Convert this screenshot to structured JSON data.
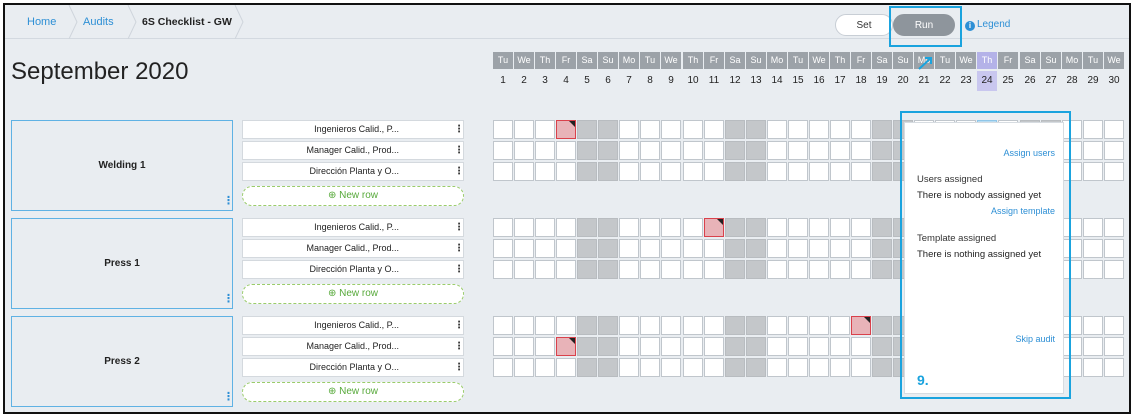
{
  "breadcrumb": {
    "home": "Home",
    "audits": "Audits",
    "current": "6S Checklist - GW"
  },
  "mode": {
    "set_label": "Set",
    "run_label": "Run",
    "legend_label": "Legend"
  },
  "month_title": "September 2020",
  "days": [
    {
      "abbr": "Tu",
      "num": "1"
    },
    {
      "abbr": "We",
      "num": "2"
    },
    {
      "abbr": "Th",
      "num": "3"
    },
    {
      "abbr": "Fr",
      "num": "4"
    },
    {
      "abbr": "Sa",
      "num": "5"
    },
    {
      "abbr": "Su",
      "num": "6"
    },
    {
      "abbr": "Mo",
      "num": "7"
    },
    {
      "abbr": "Tu",
      "num": "8"
    },
    {
      "abbr": "We",
      "num": "9"
    },
    {
      "abbr": "Th",
      "num": "10"
    },
    {
      "abbr": "Fr",
      "num": "11"
    },
    {
      "abbr": "Sa",
      "num": "12"
    },
    {
      "abbr": "Su",
      "num": "13"
    },
    {
      "abbr": "Mo",
      "num": "14"
    },
    {
      "abbr": "Tu",
      "num": "15"
    },
    {
      "abbr": "We",
      "num": "16"
    },
    {
      "abbr": "Th",
      "num": "17"
    },
    {
      "abbr": "Fr",
      "num": "18"
    },
    {
      "abbr": "Sa",
      "num": "19"
    },
    {
      "abbr": "Su",
      "num": "20"
    },
    {
      "abbr": "Mo",
      "num": "21"
    },
    {
      "abbr": "Tu",
      "num": "22"
    },
    {
      "abbr": "We",
      "num": "23"
    },
    {
      "abbr": "Th",
      "num": "24"
    },
    {
      "abbr": "Fr",
      "num": "25"
    },
    {
      "abbr": "Sa",
      "num": "26"
    },
    {
      "abbr": "Su",
      "num": "27"
    },
    {
      "abbr": "Mo",
      "num": "28"
    },
    {
      "abbr": "Tu",
      "num": "29"
    },
    {
      "abbr": "We",
      "num": "30"
    }
  ],
  "selected_day": "24",
  "areas": [
    {
      "name": "Welding 1",
      "rows": [
        "Ingenieros Calid., P...",
        "Manager Calid., Prod...",
        "Dirección Planta y O..."
      ],
      "new_row_label": "New row"
    },
    {
      "name": "Press 1",
      "rows": [
        "Ingenieros Calid., P...",
        "Manager Calid., Prod...",
        "Dirección Planta y O..."
      ],
      "new_row_label": "New row"
    },
    {
      "name": "Press 2",
      "rows": [
        "Ingenieros Calid., P...",
        "Manager Calid., Prod...",
        "Dirección Planta y O..."
      ],
      "new_row_label": "New row"
    }
  ],
  "flagged_cells": [
    {
      "area": 0,
      "row": 0,
      "day": "4"
    },
    {
      "area": 1,
      "row": 0,
      "day": "11"
    },
    {
      "area": 2,
      "row": 0,
      "day": "18"
    },
    {
      "area": 2,
      "row": 1,
      "day": "4"
    }
  ],
  "popup": {
    "assign_users": "Assign users",
    "users_label": "Users assigned",
    "users_value": "There is nobody assigned yet",
    "assign_template": "Assign template",
    "template_label": "Template assigned",
    "template_value": "There is nothing assigned yet",
    "skip_audit": "Skip audit"
  },
  "annotation_step": "9.",
  "colors": {
    "accent": "#1aa3de",
    "link": "#2d8fd5",
    "flag": "#d9414b",
    "weekend": "#c4c7ca"
  }
}
